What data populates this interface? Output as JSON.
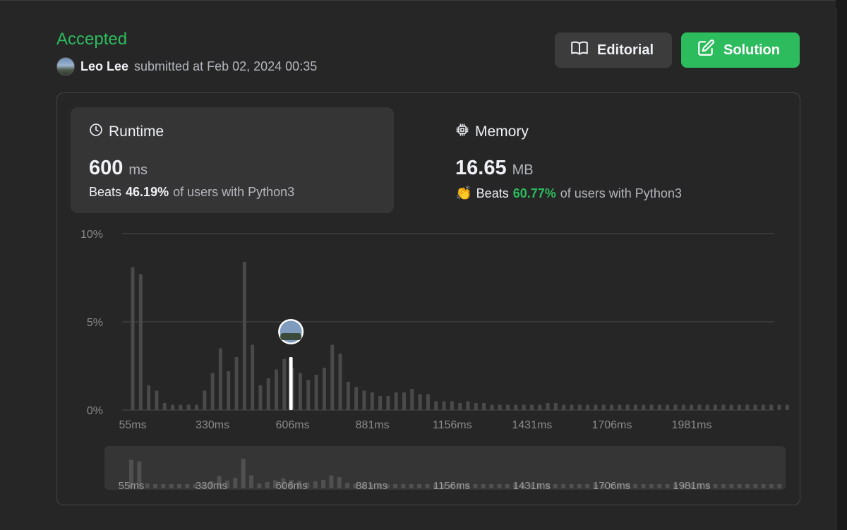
{
  "submission": {
    "status": "Accepted",
    "author": "Leo Lee",
    "submitted_text": "submitted at Feb 02, 2024 00:35"
  },
  "buttons": {
    "editorial": "Editorial",
    "solution": "Solution"
  },
  "runtime": {
    "label": "Runtime",
    "value": "600",
    "unit": "ms",
    "beats_prefix": "Beats",
    "beats_pct": "46.19%",
    "beats_suffix": "of users with Python3",
    "icon": "clock-icon"
  },
  "memory": {
    "label": "Memory",
    "value": "16.65",
    "unit": "MB",
    "beats_prefix": "Beats",
    "beats_pct": "60.77%",
    "beats_suffix": "of users with Python3",
    "icon": "chip-icon"
  },
  "colors": {
    "accent_green": "#2cbb5d",
    "bar": "#4a4a4a",
    "highlight_bar": "#ffffff"
  },
  "chart_data": {
    "type": "bar",
    "y_ticks": [
      "10%",
      "5%",
      "0%"
    ],
    "ylim": [
      0,
      10
    ],
    "x_ticks": [
      "55ms",
      "330ms",
      "606ms",
      "881ms",
      "1156ms",
      "1431ms",
      "1706ms",
      "1981ms"
    ],
    "x_tick_values": [
      55,
      330,
      606,
      881,
      1156,
      1431,
      1706,
      1981
    ],
    "x_start": 55,
    "x_step": 27.5,
    "values": [
      8.1,
      7.7,
      1.4,
      1.1,
      0.4,
      0.3,
      0.3,
      0.3,
      0.3,
      1.1,
      2.1,
      3.5,
      2.2,
      3.0,
      8.4,
      3.7,
      1.4,
      1.8,
      2.3,
      2.9,
      2.4,
      2.1,
      1.7,
      2.0,
      2.4,
      3.7,
      3.2,
      1.6,
      1.3,
      1.1,
      1.0,
      0.8,
      0.8,
      1.0,
      1.0,
      1.2,
      0.9,
      0.9,
      0.5,
      0.5,
      0.5,
      0.4,
      0.5,
      0.4,
      0.4,
      0.3,
      0.3,
      0.3,
      0.3,
      0.3,
      0.3,
      0.3,
      0.4,
      0.4,
      0.3,
      0.3,
      0.3,
      0.3,
      0.3,
      0.3,
      0.3,
      0.3,
      0.3,
      0.3,
      0.3,
      0.3,
      0.3,
      0.3,
      0.3,
      0.3,
      0.3,
      0.3,
      0.3,
      0.3,
      0.3,
      0.3,
      0.3,
      0.3,
      0.3,
      0.3,
      0.3,
      0.3,
      0.3
    ],
    "highlight": {
      "x": 600,
      "value": 3.0
    },
    "grid": true
  }
}
